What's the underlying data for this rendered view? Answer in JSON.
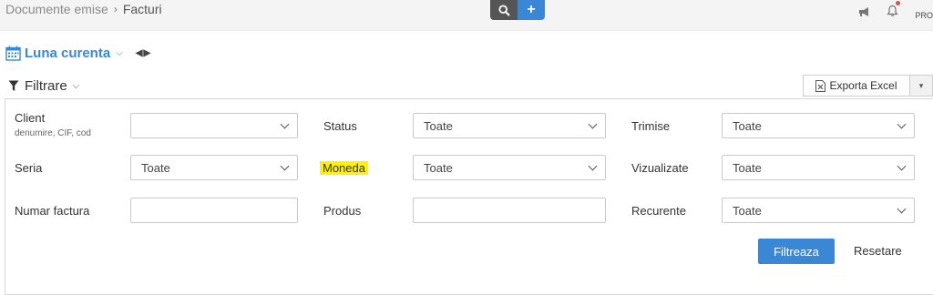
{
  "breadcrumb": {
    "section": "Documente emise",
    "separator": "›",
    "current": "Facturi"
  },
  "topbar": {
    "search_icon": "search-icon",
    "add_label": "+",
    "pro_label": "PRO"
  },
  "period": {
    "label": "Luna curenta",
    "nav_arrows": "◀▶"
  },
  "filter_toggle": {
    "label": "Filtrare"
  },
  "export": {
    "label": "Exporta Excel"
  },
  "filters": {
    "client": {
      "label": "Client",
      "sublabel": "denumire, CIF, cod",
      "value": ""
    },
    "status": {
      "label": "Status",
      "value": "Toate"
    },
    "trimise": {
      "label": "Trimise",
      "value": "Toate"
    },
    "seria": {
      "label": "Seria",
      "value": "Toate"
    },
    "moneda": {
      "label": "Moneda",
      "value": "Toate"
    },
    "vizualizate": {
      "label": "Vizualizate",
      "value": "Toate"
    },
    "numar_factura": {
      "label": "Numar factura",
      "value": ""
    },
    "produs": {
      "label": "Produs",
      "value": ""
    },
    "recurente": {
      "label": "Recurente",
      "value": "Toate"
    }
  },
  "actions": {
    "filter_label": "Filtreaza",
    "reset_label": "Resetare"
  },
  "colors": {
    "accent": "#3a87d6",
    "highlight": "#fff200",
    "dark_button": "#555555"
  }
}
